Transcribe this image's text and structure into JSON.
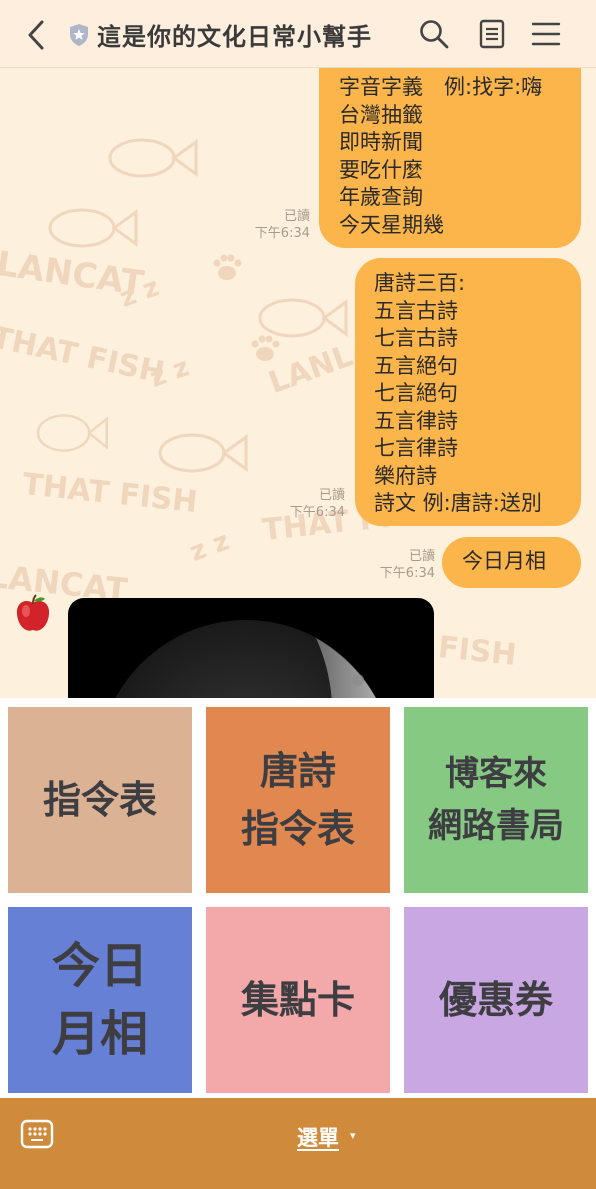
{
  "header": {
    "title": "這是你的文化日常小幫手",
    "back_icon": "chevron-left-icon",
    "verified_icon": "shield-icon",
    "icons": [
      "search-icon",
      "notes-icon",
      "hamburger-menu-icon"
    ]
  },
  "watermark": {
    "texts": [
      "LANCAT",
      "THAT FISH",
      "THAT FISH",
      "LANLAN",
      "LANCAT",
      "FISH",
      "THAT FISH"
    ],
    "z": "z z"
  },
  "messages": [
    {
      "text": "字音字義　例:找字:嗨\n台灣抽籤\n即時新聞\n要吃什麼\n年歲查詢\n今天星期幾",
      "read": "已讀",
      "time": "下午6:34"
    },
    {
      "text": "唐詩三百:\n五言古詩\n七言古詩\n五言絕句\n七言絕句\n五言律詩\n七言律詩\n樂府詩\n詩文 例:唐詩:送別",
      "read": "已讀",
      "time": "下午6:34"
    },
    {
      "text": "今日月相",
      "read": "已讀",
      "time": "下午6:34"
    }
  ],
  "incoming": {
    "avatar": "apple-avatar",
    "image": "moon-phase-photo"
  },
  "rich_menu": {
    "tiles": [
      {
        "line1": "指令表",
        "line2": "",
        "color": "#dbb293"
      },
      {
        "line1": "唐詩",
        "line2": "指令表",
        "color": "#e0884f"
      },
      {
        "line1": "博客來",
        "line2": "網路書局",
        "color": "#86c983"
      },
      {
        "line1": "今日",
        "line2": "月相",
        "color": "#6680d6"
      },
      {
        "line1": "集點卡",
        "line2": "",
        "color": "#f3a9a9"
      },
      {
        "line1": "優惠券",
        "line2": "",
        "color": "#c9a7e2"
      }
    ]
  },
  "bottom_bar": {
    "keyboard_icon": "keyboard-icon",
    "menu_label": "選單",
    "caret": "▾"
  },
  "colors": {
    "bubble": "#fbb54a",
    "bottom_bar": "#cf8a3c",
    "header": "#fdeedd"
  }
}
